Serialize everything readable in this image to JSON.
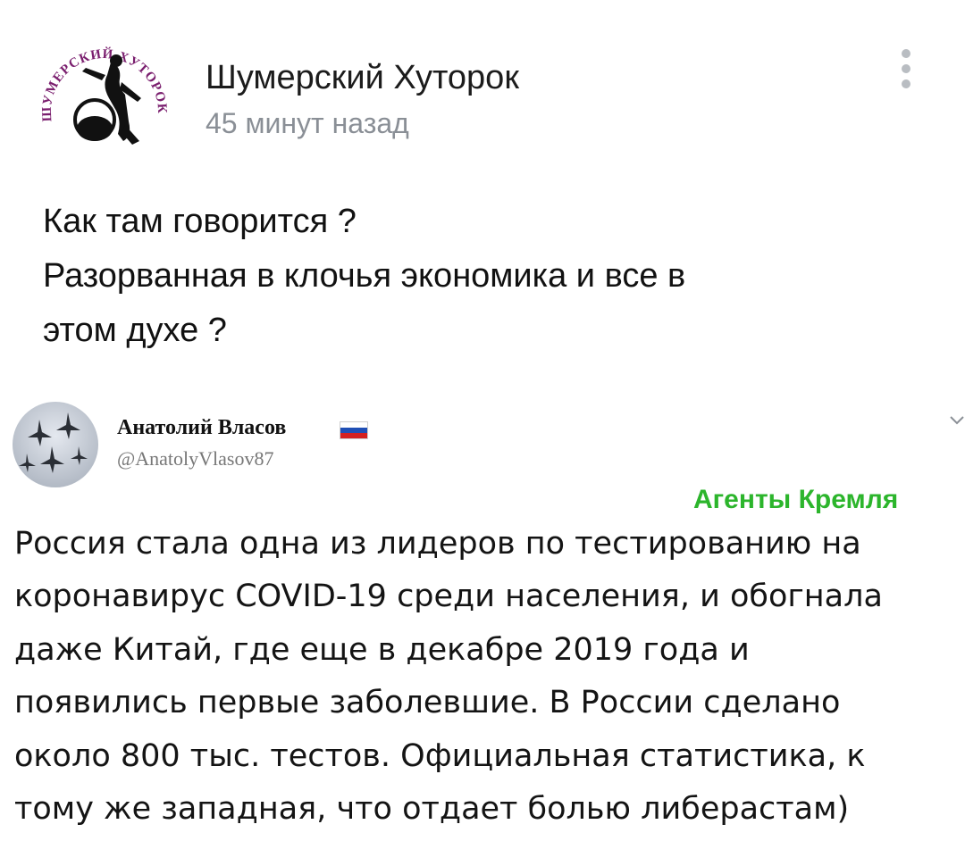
{
  "post": {
    "group_name": "Шумерский Хуторок",
    "time": "45 минут назад",
    "text_lines": [
      "Как там говорится ?",
      "Разорванная в клочья экономика и все в",
      "этом духе ?"
    ],
    "logo_text": "ШУМЕРСКИЙ ХУТОРОК",
    "icons": {
      "menu": "more-vertical-icon"
    }
  },
  "tweet": {
    "author": "Анатолий Власов",
    "handle": "@AnatolyVlasov87",
    "flag": "russian-flag-icon",
    "flag_colors": [
      "#ffffff",
      "#1f4fb5",
      "#d32020"
    ],
    "stamp": "Агенты Кремля",
    "stamp_color": "#2cb52c",
    "text_lines": [
      "Россия стала одна из лидеров по тестированию на",
      "коронавирус COVID-19 среди населения, и обогнала",
      "даже Китай, где еще в декабре 2019 года и",
      "появились первые заболевшие. В России сделано",
      "около 800 тыс. тестов. Официальная статистика, к",
      "тому же западная, что отдает болью либерастам)"
    ]
  }
}
